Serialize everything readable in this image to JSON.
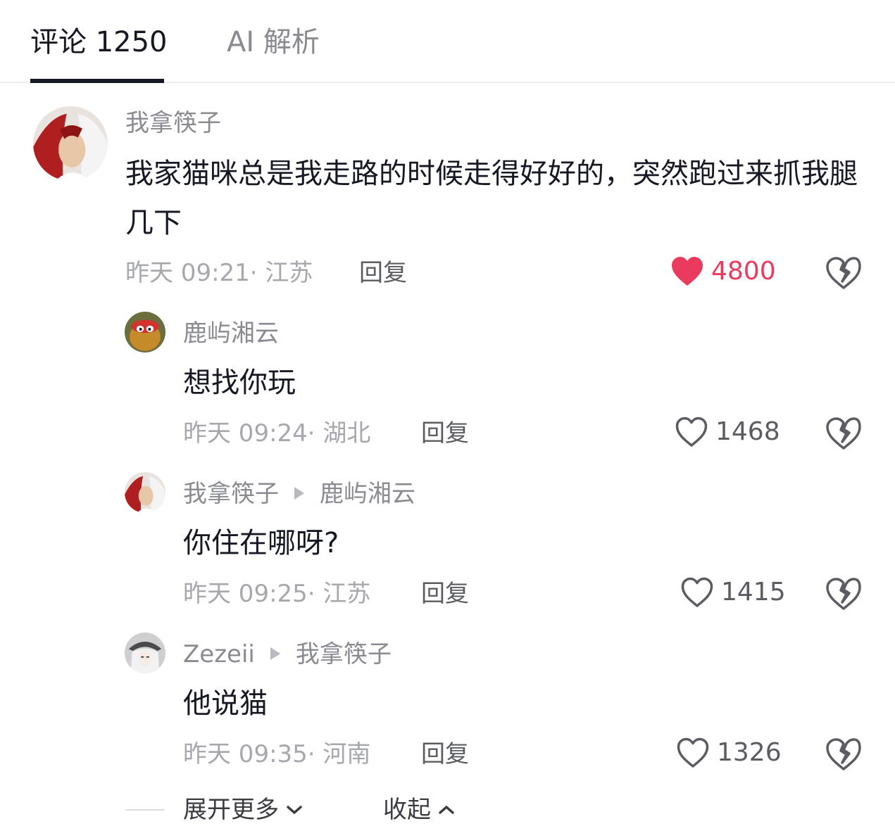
{
  "tabs": {
    "comments_label": "评论 1250",
    "ai_label": "AI 解析"
  },
  "comments": [
    {
      "username": "我拿筷子",
      "text": "我家猫咪总是我走路的时候走得好好的，突然跑过来抓我腿几下",
      "time_location": "昨天 09:21· 江苏",
      "reply_label": "回复",
      "likes": "4800",
      "liked": true
    },
    {
      "username": "鹿屿湘云",
      "text": "想找你玩",
      "time_location": "昨天 09:24· 湖北",
      "reply_label": "回复",
      "likes": "1468",
      "liked": false
    },
    {
      "username": "我拿筷子",
      "reply_to": "鹿屿湘云",
      "text": "你住在哪呀?",
      "time_location": "昨天 09:25· 江苏",
      "reply_label": "回复",
      "likes": "1415",
      "liked": false
    },
    {
      "username": "Zezeii",
      "reply_to": "我拿筷子",
      "text": "他说猫",
      "time_location": "昨天 09:35· 河南",
      "reply_label": "回复",
      "likes": "1326",
      "liked": false
    }
  ],
  "footer": {
    "expand_label": "展开更多",
    "collapse_label": "收起"
  },
  "icons": {
    "like": "heart-icon",
    "dislike": "broken-heart-icon",
    "expand": "chevron-down-icon",
    "collapse": "chevron-up-icon"
  },
  "colors": {
    "liked": "#ea3a5d",
    "text": "#161823",
    "secondary": "#8a8b91"
  }
}
